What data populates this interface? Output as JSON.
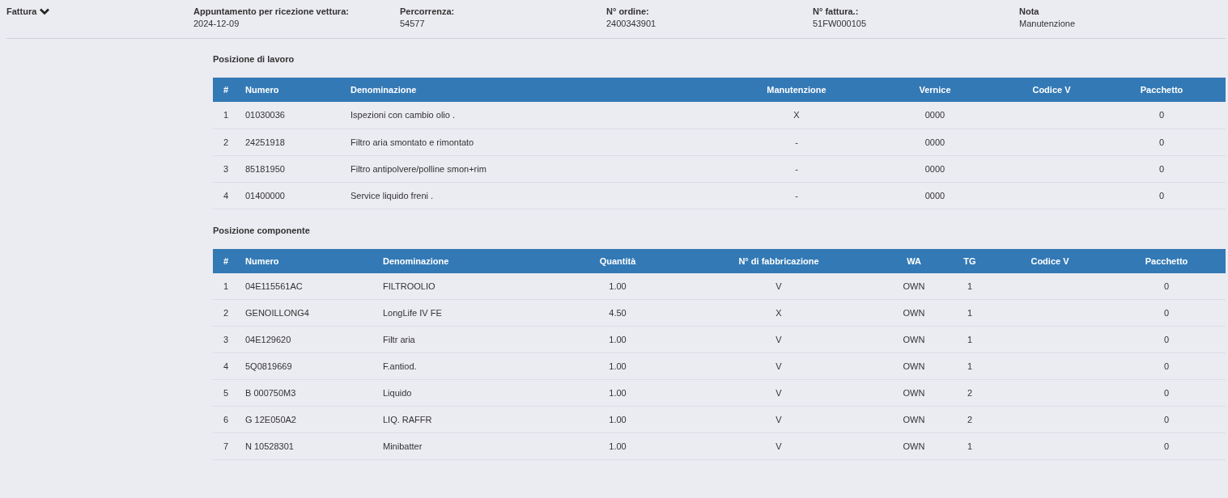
{
  "section_toggle": {
    "label": "Fattura",
    "expanded": true
  },
  "fields": [
    {
      "label": "Appuntamento per ricezione vettura:",
      "value": "2024-12-09"
    },
    {
      "label": "Percorrenza:",
      "value": "54577"
    },
    {
      "label": "N° ordine:",
      "value": "2400343901"
    },
    {
      "label": "N° fattura.:",
      "value": "51FW000105"
    },
    {
      "label": "Nota",
      "value": "Manutenzione"
    }
  ],
  "tables": [
    {
      "title": "Posizione di lavoro",
      "columns": [
        "#",
        "Numero",
        "Denominazione",
        "Manutenzione",
        "Vernice",
        "Codice V",
        "Pacchetto"
      ],
      "rows": [
        [
          "1",
          "01030036",
          "Ispezioni con cambio olio .",
          "X",
          "0000",
          "",
          "0"
        ],
        [
          "2",
          "24251918",
          "Filtro aria smontato e rimontato",
          "-",
          "0000",
          "",
          "0"
        ],
        [
          "3",
          "85181950",
          "Filtro antipolvere/polline smon+rim",
          "-",
          "0000",
          "",
          "0"
        ],
        [
          "4",
          "01400000",
          "Service liquido freni .",
          "-",
          "0000",
          "",
          "0"
        ]
      ]
    },
    {
      "title": "Posizione componente",
      "columns": [
        "#",
        "Numero",
        "Denominazione",
        "Quantità",
        "N° di fabbricazione",
        "WA",
        "TG",
        "Codice V",
        "Pacchetto"
      ],
      "rows": [
        [
          "1",
          "04E115561AC",
          "FILTROOLIO",
          "1.00",
          "V",
          "OWN",
          "1",
          "",
          "0"
        ],
        [
          "2",
          "GENOILLONG4",
          "LongLife IV FE",
          "4.50",
          "X",
          "OWN",
          "1",
          "",
          "0"
        ],
        [
          "3",
          "04E129620",
          "Filtr aria",
          "1.00",
          "V",
          "OWN",
          "1",
          "",
          "0"
        ],
        [
          "4",
          "5Q0819669",
          "F.antiod.",
          "1.00",
          "V",
          "OWN",
          "1",
          "",
          "0"
        ],
        [
          "5",
          "B 000750M3",
          "Liquido",
          "1.00",
          "V",
          "OWN",
          "2",
          "",
          "0"
        ],
        [
          "6",
          "G 12E050A2",
          "LIQ. RAFFR",
          "1.00",
          "V",
          "OWN",
          "2",
          "",
          "0"
        ],
        [
          "7",
          "N 10528301",
          "Minibatter",
          "1.00",
          "V",
          "OWN",
          "1",
          "",
          "0"
        ]
      ]
    }
  ]
}
